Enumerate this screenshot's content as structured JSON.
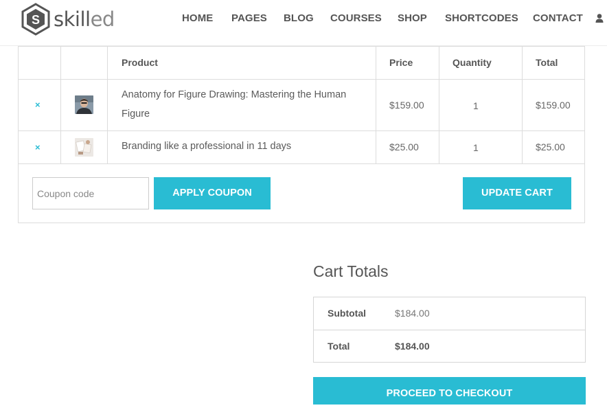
{
  "brand": {
    "name_bold": "skill",
    "name_light": "ed",
    "logo_letter": "S"
  },
  "nav": {
    "items": [
      "HOME",
      "PAGES",
      "BLOG",
      "COURSES",
      "SHOP",
      "SHORTCODES",
      "CONTACT"
    ],
    "user_icon": "user-icon"
  },
  "cart": {
    "columns": {
      "product": "Product",
      "price": "Price",
      "quantity": "Quantity",
      "total": "Total"
    },
    "rows": [
      {
        "remove": "×",
        "product_line1": "Anatomy for Figure Drawing: Mastering the Human",
        "product_line2": "Figure",
        "price": "$159.00",
        "quantity": "1",
        "total": "$159.00",
        "thumb": "man-portrait"
      },
      {
        "remove": "×",
        "product_line1": "Branding like a professional in 11 days",
        "price": "$25.00",
        "quantity": "1",
        "total": "$25.00",
        "thumb": "branding-items"
      }
    ],
    "coupon_placeholder": "Coupon code",
    "apply_coupon_label": "APPLY COUPON",
    "update_cart_label": "UPDATE CART"
  },
  "totals": {
    "title": "Cart Totals",
    "subtotal_label": "Subtotal",
    "subtotal_value": "$184.00",
    "total_label": "Total",
    "total_value": "$184.00",
    "checkout_label": "PROCEED TO CHECKOUT"
  },
  "colors": {
    "accent": "#29bcd3",
    "text": "#555555",
    "border": "#dcdcdc"
  }
}
